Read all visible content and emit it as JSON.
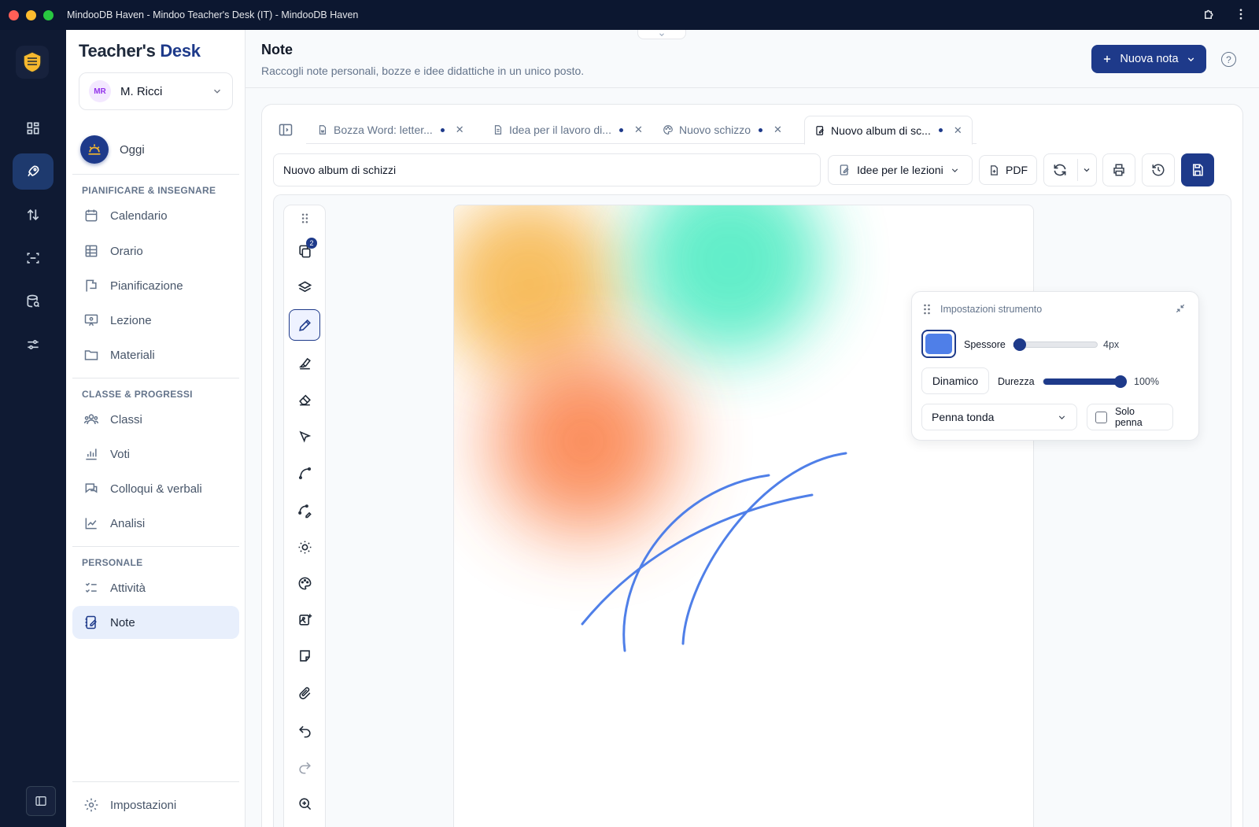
{
  "window": {
    "title": "MindooDB Haven - Mindoo Teacher's Desk (IT) - MindooDB Haven"
  },
  "brand": {
    "part1": "Teacher's",
    "part2": "Desk"
  },
  "user": {
    "initials": "MR",
    "name": "M. Ricci"
  },
  "today_label": "Oggi",
  "sections": {
    "plan": "PIANIFICARE & INSEGNARE",
    "class": "CLASSE & PROGRESSI",
    "personal": "PERSONALE"
  },
  "nav": {
    "plan": [
      "Calendario",
      "Orario",
      "Pianificazione",
      "Lezione",
      "Materiali"
    ],
    "class": [
      "Classi",
      "Voti",
      "Colloqui & verbali",
      "Analisi"
    ],
    "personal": [
      "Attività",
      "Note"
    ],
    "settings": "Impostazioni"
  },
  "page": {
    "title": "Note",
    "subtitle": "Raccogli note personali, bozze e idee didattiche in un unico posto.",
    "new_note": "Nuova nota"
  },
  "tabs": [
    {
      "label": "Bozza Word: letter...",
      "icon": "document-icon"
    },
    {
      "label": "Idea per il lavoro di...",
      "icon": "document-lines-icon"
    },
    {
      "label": "Nuovo schizzo",
      "icon": "palette-icon"
    },
    {
      "label": "Nuovo album di sc...",
      "icon": "sketchbook-icon"
    }
  ],
  "editor": {
    "title_value": "Nuovo album di schizzi",
    "folder": "Idee per le lezioni",
    "pdf": "PDF"
  },
  "toolbar": {
    "pages_badge": "2"
  },
  "tool_settings": {
    "title": "Impostazioni strumento",
    "color": "#4f7fe8",
    "thickness_label": "Spessore",
    "thickness_value": "4px",
    "thickness_fraction": 0.05,
    "dynamic": "Dinamico",
    "hardness_label": "Durezza",
    "hardness_value": "100%",
    "hardness_fraction": 1.0,
    "pen_type": "Penna tonda",
    "pen_only": "Solo penna"
  },
  "colors": {
    "accent": "#1e3a8a",
    "stroke": "#4f7fe8"
  }
}
